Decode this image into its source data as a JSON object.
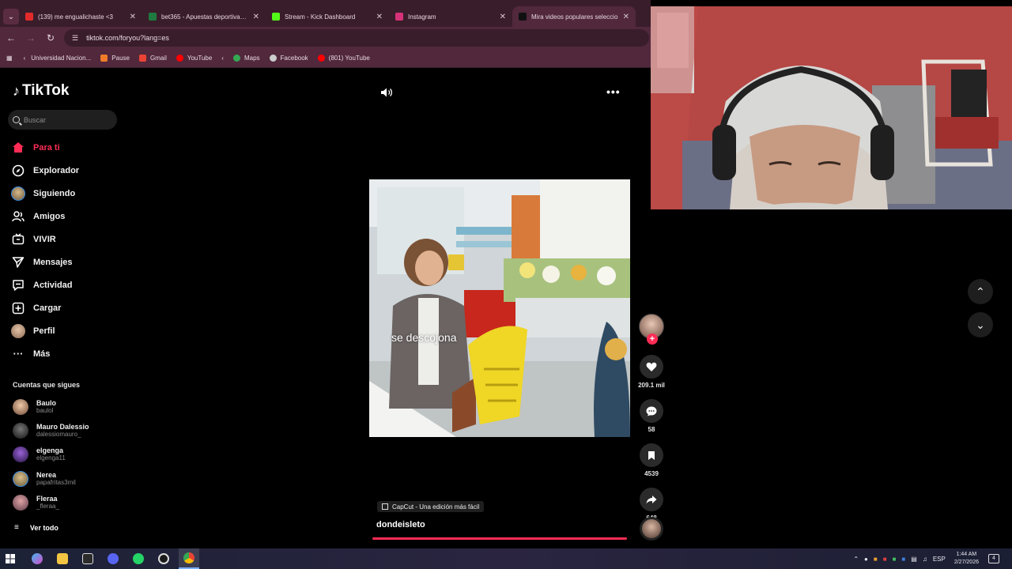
{
  "browser": {
    "tabs": [
      {
        "title": "(139) me engualichaste <3",
        "fav_color": "#e12b2b"
      },
      {
        "title": "bet365 - Apuestas deportivas e",
        "fav_color": "#1e7b3f"
      },
      {
        "title": "Stream - Kick Dashboard",
        "fav_color": "#53fc18"
      },
      {
        "title": "Instagram",
        "fav_color": "#d6327a"
      },
      {
        "title": "Mira videos populares seleccio",
        "fav_color": "#111111"
      }
    ],
    "url": "tiktok.com/foryou?lang=es",
    "bookmarks": [
      {
        "label": "Universidad Nacion...",
        "color": "#8a5a2b"
      },
      {
        "label": "Pause",
        "color": "#f07b2a"
      },
      {
        "label": "Gmail",
        "color": "#ea4335"
      },
      {
        "label": "YouTube",
        "color": "#ff0000"
      },
      {
        "label": "Maps",
        "color": "#34a853"
      },
      {
        "label": "Facebook",
        "color": "#cccccc"
      },
      {
        "label": "(801) YouTube",
        "color": "#ff0000"
      }
    ]
  },
  "tiktok": {
    "logo": "TikTok",
    "search_placeholder": "Buscar",
    "menu": [
      {
        "label": "Para ti",
        "icon": "home-icon"
      },
      {
        "label": "Explorador",
        "icon": "compass-icon"
      },
      {
        "label": "Siguiendo",
        "icon": "following-avatar"
      },
      {
        "label": "Amigos",
        "icon": "friends-icon"
      },
      {
        "label": "VIVIR",
        "icon": "live-icon"
      },
      {
        "label": "Mensajes",
        "icon": "send-icon"
      },
      {
        "label": "Actividad",
        "icon": "activity-icon"
      },
      {
        "label": "Cargar",
        "icon": "upload-icon"
      },
      {
        "label": "Perfil",
        "icon": "profile-avatar"
      },
      {
        "label": "Más",
        "icon": "more-icon"
      }
    ],
    "following_title": "Cuentas que sigues",
    "accounts": [
      {
        "name": "Baulo",
        "handle": "baulol"
      },
      {
        "name": "Mauro Dalessio",
        "handle": "dalessiomauro_"
      },
      {
        "name": "elgenga",
        "handle": "elgenga11"
      },
      {
        "name": "Nerea",
        "handle": "papafritas3mil"
      },
      {
        "name": "Fleraa",
        "handle": "_fleraa_"
      }
    ],
    "see_all": "Ver todo",
    "video": {
      "caption": "se descojona",
      "likes": "209.1 mil",
      "comments": "58",
      "saves": "4539",
      "shares": "648",
      "capcut": "CapCut - Una edición más fácil",
      "author": "dondeisleto",
      "accent": "#fe2c55"
    }
  },
  "taskbar": {
    "lang": "ESP",
    "time": "1:44 AM",
    "date": "2/27/2026",
    "notifications": "4"
  }
}
